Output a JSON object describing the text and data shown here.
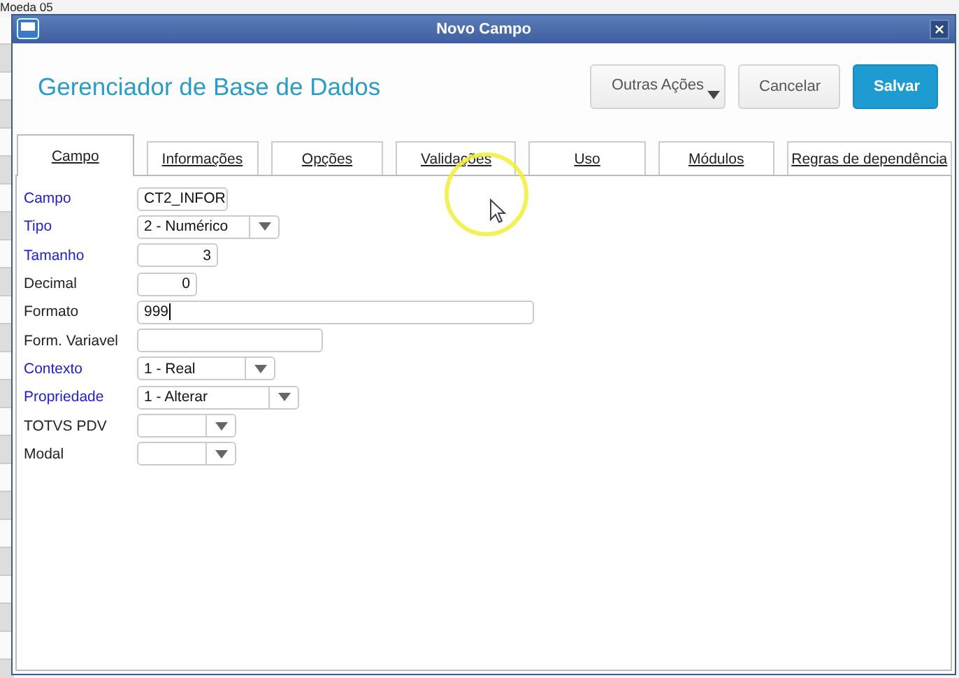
{
  "background": {
    "title": "Moeda 05"
  },
  "window": {
    "title": "Novo Campo"
  },
  "header": {
    "title": "Gerenciador de Base de Dados",
    "buttons": [
      {
        "label": "Outras Ações",
        "kind": "menu"
      },
      {
        "label": "Cancelar",
        "kind": "plain"
      },
      {
        "label": "Salvar",
        "kind": "primary"
      }
    ]
  },
  "tabs": [
    {
      "label": "Campo",
      "selected": true
    },
    {
      "label": "Informações",
      "selected": false
    },
    {
      "label": "Opções",
      "selected": false
    },
    {
      "label": "Validações",
      "selected": false
    },
    {
      "label": "Uso",
      "selected": false
    },
    {
      "label": "Módulos",
      "selected": false
    },
    {
      "label": "Regras de dependência",
      "selected": false
    }
  ],
  "fields": [
    {
      "label": "Campo",
      "required": true,
      "kind": "text",
      "value": "CT2_INFOR"
    },
    {
      "label": "Tipo",
      "required": true,
      "kind": "combo",
      "value": "2 - Numérico"
    },
    {
      "label": "Tamanho",
      "required": true,
      "kind": "number",
      "value": "3"
    },
    {
      "label": "Decimal",
      "required": false,
      "kind": "number",
      "value": "0"
    },
    {
      "label": "Formato",
      "required": false,
      "kind": "text",
      "value": "999",
      "focused": true
    },
    {
      "label": "Form. Variavel",
      "required": false,
      "kind": "text"
    },
    {
      "label": "Contexto",
      "required": true,
      "kind": "combo",
      "value": "1 - Real"
    },
    {
      "label": "Propriedade",
      "required": true,
      "kind": "combo",
      "value": "1 - Alterar"
    },
    {
      "label": "TOTVS PDV",
      "required": false,
      "kind": "combo"
    },
    {
      "label": "Modal",
      "required": false,
      "kind": "combo"
    }
  ]
}
